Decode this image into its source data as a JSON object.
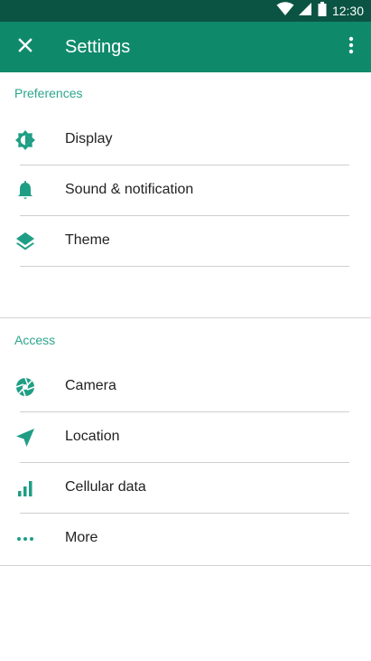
{
  "status_bar": {
    "time": "12:30"
  },
  "app_bar": {
    "title": "Settings"
  },
  "sections": [
    {
      "header": "Preferences",
      "items": [
        {
          "label": "Display",
          "icon": "brightness-icon"
        },
        {
          "label": "Sound & notification",
          "icon": "bell-icon"
        },
        {
          "label": "Theme",
          "icon": "layers-icon"
        }
      ]
    },
    {
      "header": "Access",
      "items": [
        {
          "label": "Camera",
          "icon": "camera-shutter-icon"
        },
        {
          "label": "Location",
          "icon": "navigation-arrow-icon"
        },
        {
          "label": "Cellular data",
          "icon": "signal-bars-icon"
        },
        {
          "label": "More",
          "icon": "more-dots-icon"
        }
      ]
    }
  ],
  "colors": {
    "status_bar": "#0b5443",
    "app_bar": "#0e8a6b",
    "accent": "#2ca58d",
    "icon": "#1f9e86"
  }
}
